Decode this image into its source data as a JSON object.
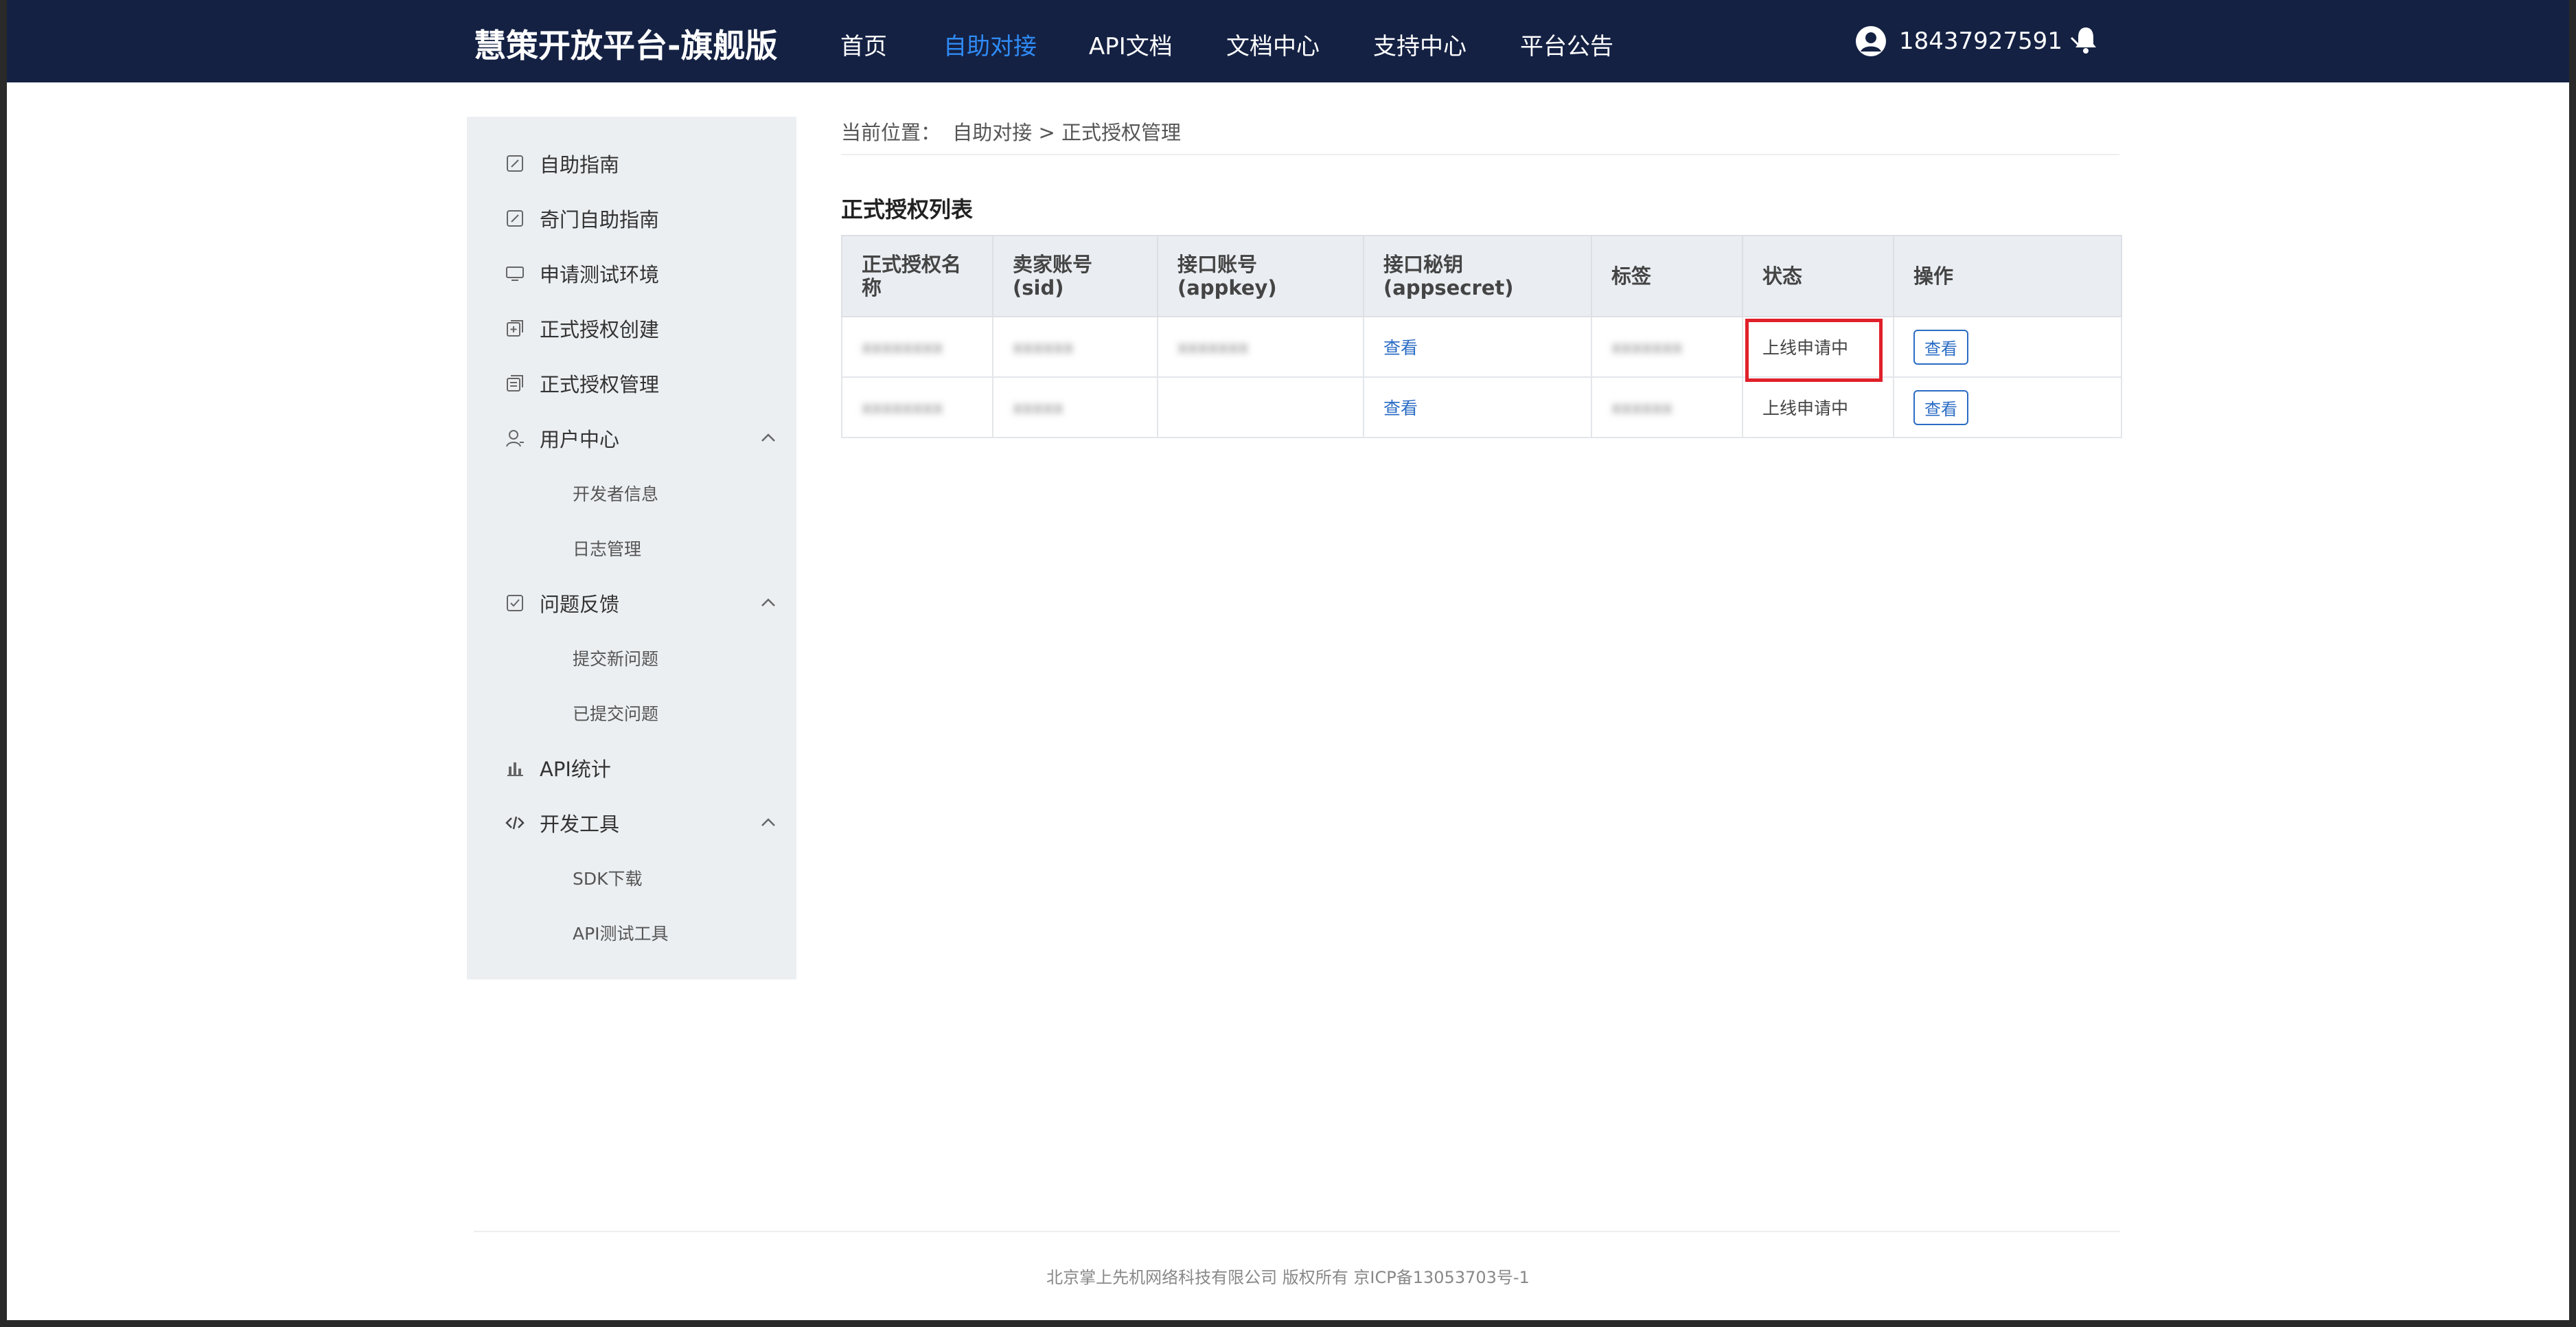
{
  "header": {
    "brand": "慧策开放平台-旗舰版",
    "nav": [
      {
        "label": "首页",
        "active": false
      },
      {
        "label": "自助对接",
        "active": true
      },
      {
        "label": "API文档",
        "active": false
      },
      {
        "label": "文档中心",
        "active": false
      },
      {
        "label": "支持中心",
        "active": false
      },
      {
        "label": "平台公告",
        "active": false
      }
    ],
    "user_phone": "18437927591",
    "icons": {
      "avatar": "user-avatar-icon",
      "dropdown": "chevron-down-icon",
      "notifications": "bell-icon"
    }
  },
  "sidebar": {
    "items": [
      {
        "label": "自助指南",
        "icon": "edit-doc-icon"
      },
      {
        "label": "奇门自助指南",
        "icon": "edit-doc-icon"
      },
      {
        "label": "申请测试环境",
        "icon": "monitor-icon"
      },
      {
        "label": "正式授权创建",
        "icon": "add-doc-icon"
      },
      {
        "label": "正式授权管理",
        "icon": "stack-doc-icon"
      },
      {
        "label": "用户中心",
        "icon": "user-icon",
        "expanded": true,
        "children": [
          "开发者信息",
          "日志管理"
        ]
      },
      {
        "label": "问题反馈",
        "icon": "checklist-icon",
        "expanded": true,
        "children": [
          "提交新问题",
          "已提交问题"
        ]
      },
      {
        "label": "API统计",
        "icon": "bar-chart-icon"
      },
      {
        "label": "开发工具",
        "icon": "code-icon",
        "expanded": true,
        "children": [
          "SDK下载",
          "API测试工具"
        ]
      }
    ]
  },
  "breadcrumb": {
    "prefix": "当前位置：",
    "path": "自助对接 > 正式授权管理"
  },
  "main": {
    "title": "正式授权列表",
    "table": {
      "columns": [
        "正式授权名称",
        "卖家账号(sid)",
        "接口账号(appkey)",
        "接口秘钥(appsecret)",
        "标签",
        "状态",
        "操作"
      ],
      "rows": [
        {
          "name": "xxxxxxxx",
          "sid": "xxxxxx",
          "appkey": "xxxxxxx",
          "secret_link": "查看",
          "tag": "xxxxxxx",
          "status": "上线申请中",
          "action": "查看"
        },
        {
          "name": "xxxxxxxx",
          "sid": "xxxxx",
          "appkey": "",
          "secret_link": "查看",
          "tag": "xxxxxx",
          "status": "上线申请中",
          "action": "查看"
        }
      ]
    }
  },
  "footer": {
    "text": "北京掌上先机网络科技有限公司 版权所有 京ICP备13053703号-1"
  },
  "colors": {
    "header_bg": "#142143",
    "active_nav": "#2f8bf6",
    "sidebar_bg": "#eceff2",
    "link": "#2b6cc4",
    "highlight": "#e0202a"
  }
}
